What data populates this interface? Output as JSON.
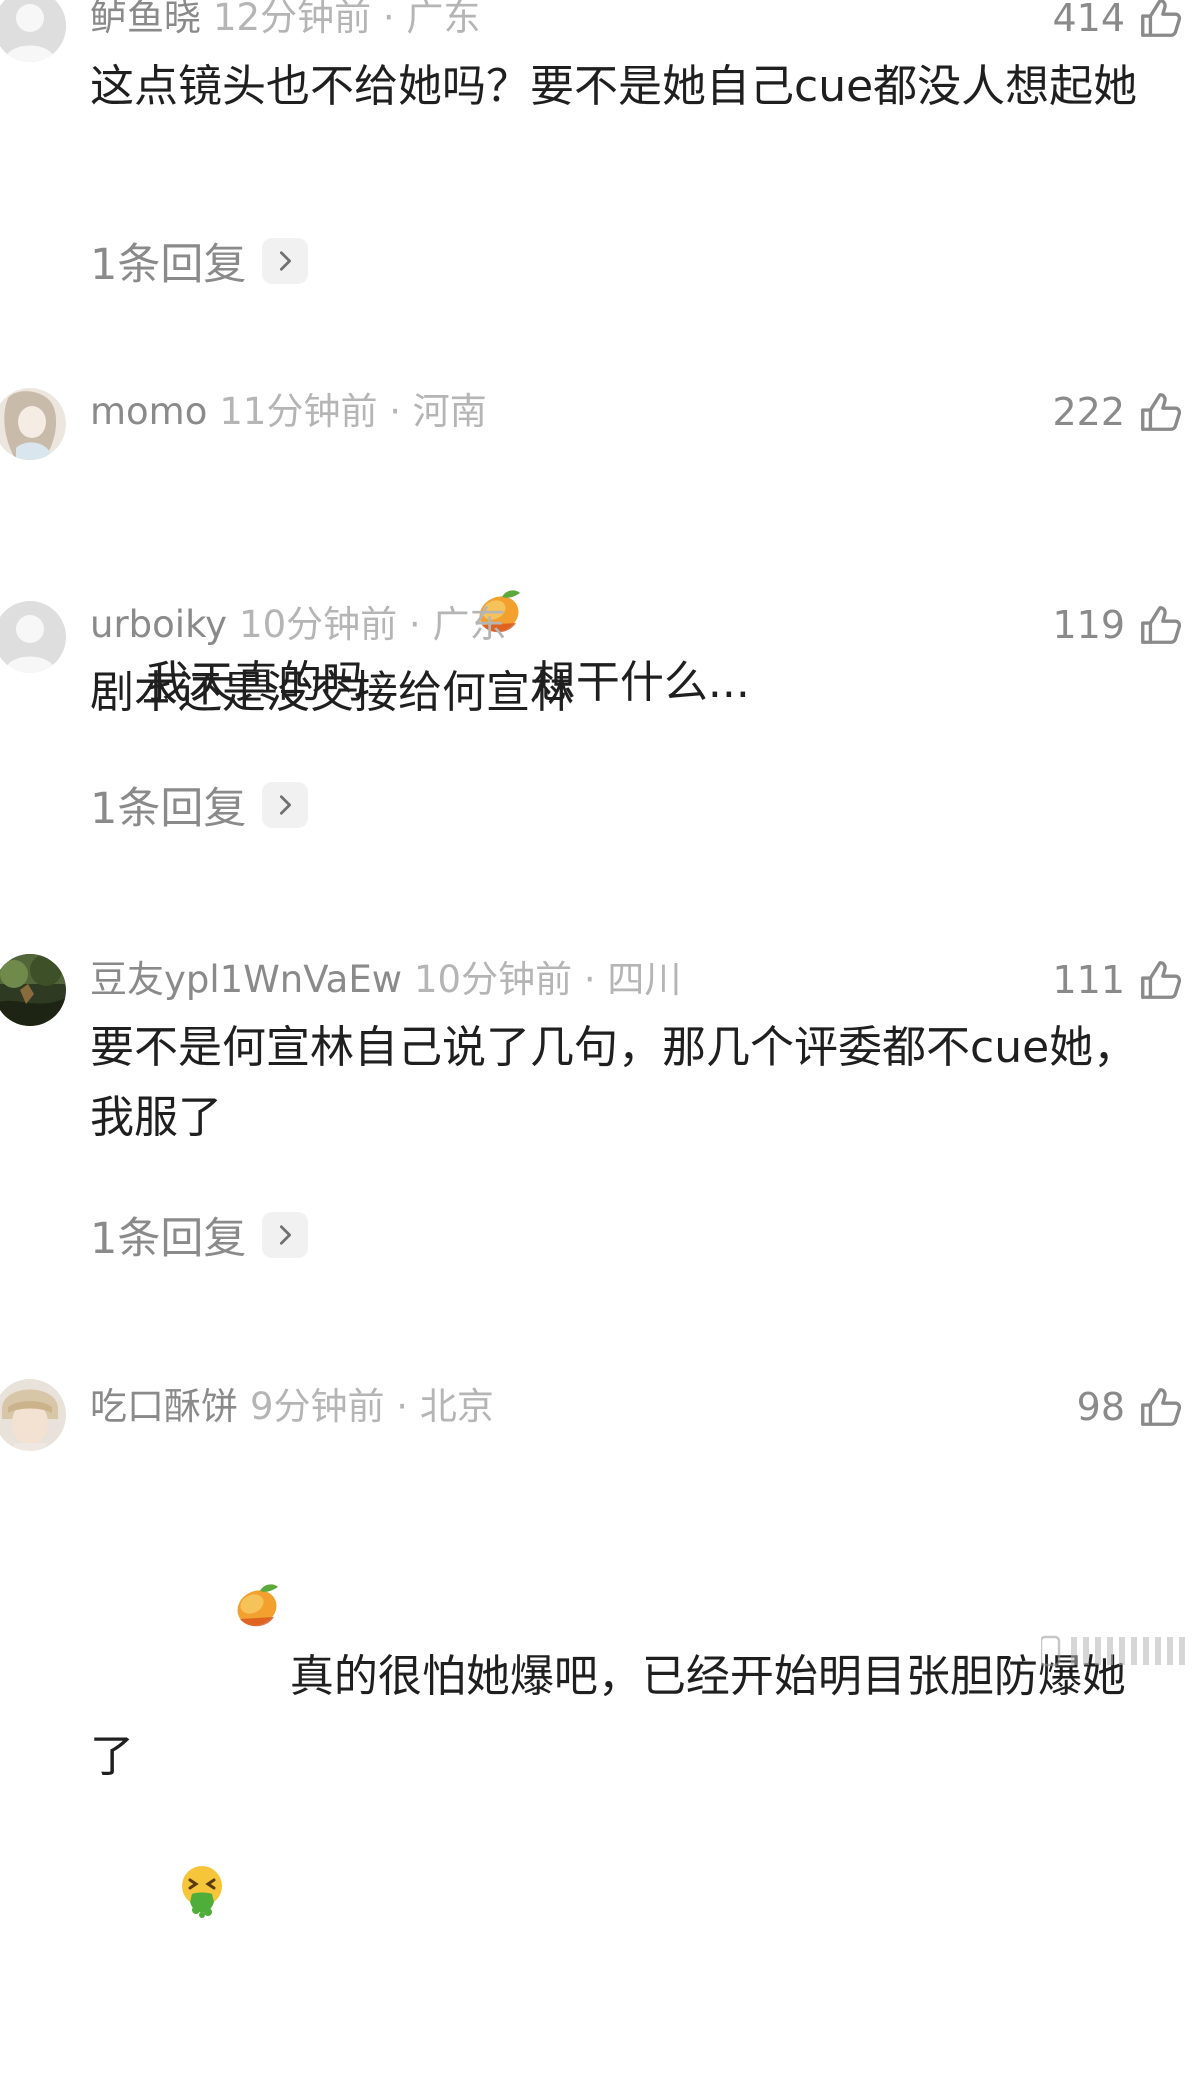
{
  "comments": [
    {
      "username": "鲈鱼晓",
      "time_location": "12分钟前 · 广东",
      "likes": "414",
      "text": "这点镜头也不给她吗？要不是她自己cue都没人想起她",
      "reply_label": "1条回复",
      "avatar_icon": "default-avatar-icon"
    },
    {
      "username": "momo",
      "time_location": "11分钟前 · 河南",
      "likes": "222",
      "text_before": "我天真的吗 ",
      "emoji": "mango-emoji",
      "text_after": "想干什么...",
      "avatar_icon": "anime-girl-avatar"
    },
    {
      "username": "urboiky",
      "time_location": "10分钟前 · 广东",
      "likes": "119",
      "text": "剧本还是没交接给何宣林",
      "reply_label": "1条回复",
      "avatar_icon": "default-avatar-icon"
    },
    {
      "username": "豆友ypl1WnVaEw",
      "time_location": "10分钟前 · 四川",
      "likes": "111",
      "text": "要不是何宣林自己说了几句，那几个评委都不cue她，我服了",
      "reply_label": "1条回复",
      "avatar_icon": "nature-photo-avatar"
    },
    {
      "username": "吃口酥饼",
      "time_location": "9分钟前 · 北京",
      "likes": "98",
      "emoji_start": "mango-emoji",
      "text": "真的很怕她爆吧，已经开始明目张胆防爆她了",
      "emoji_end": "vomiting-face-emoji",
      "avatar_icon": "person-photo-avatar"
    }
  ],
  "colors": {
    "name": "#8a8a8a",
    "time": "#b5b5b5",
    "body": "#1f1f1f",
    "reply_chip": "#f1f1f1"
  }
}
